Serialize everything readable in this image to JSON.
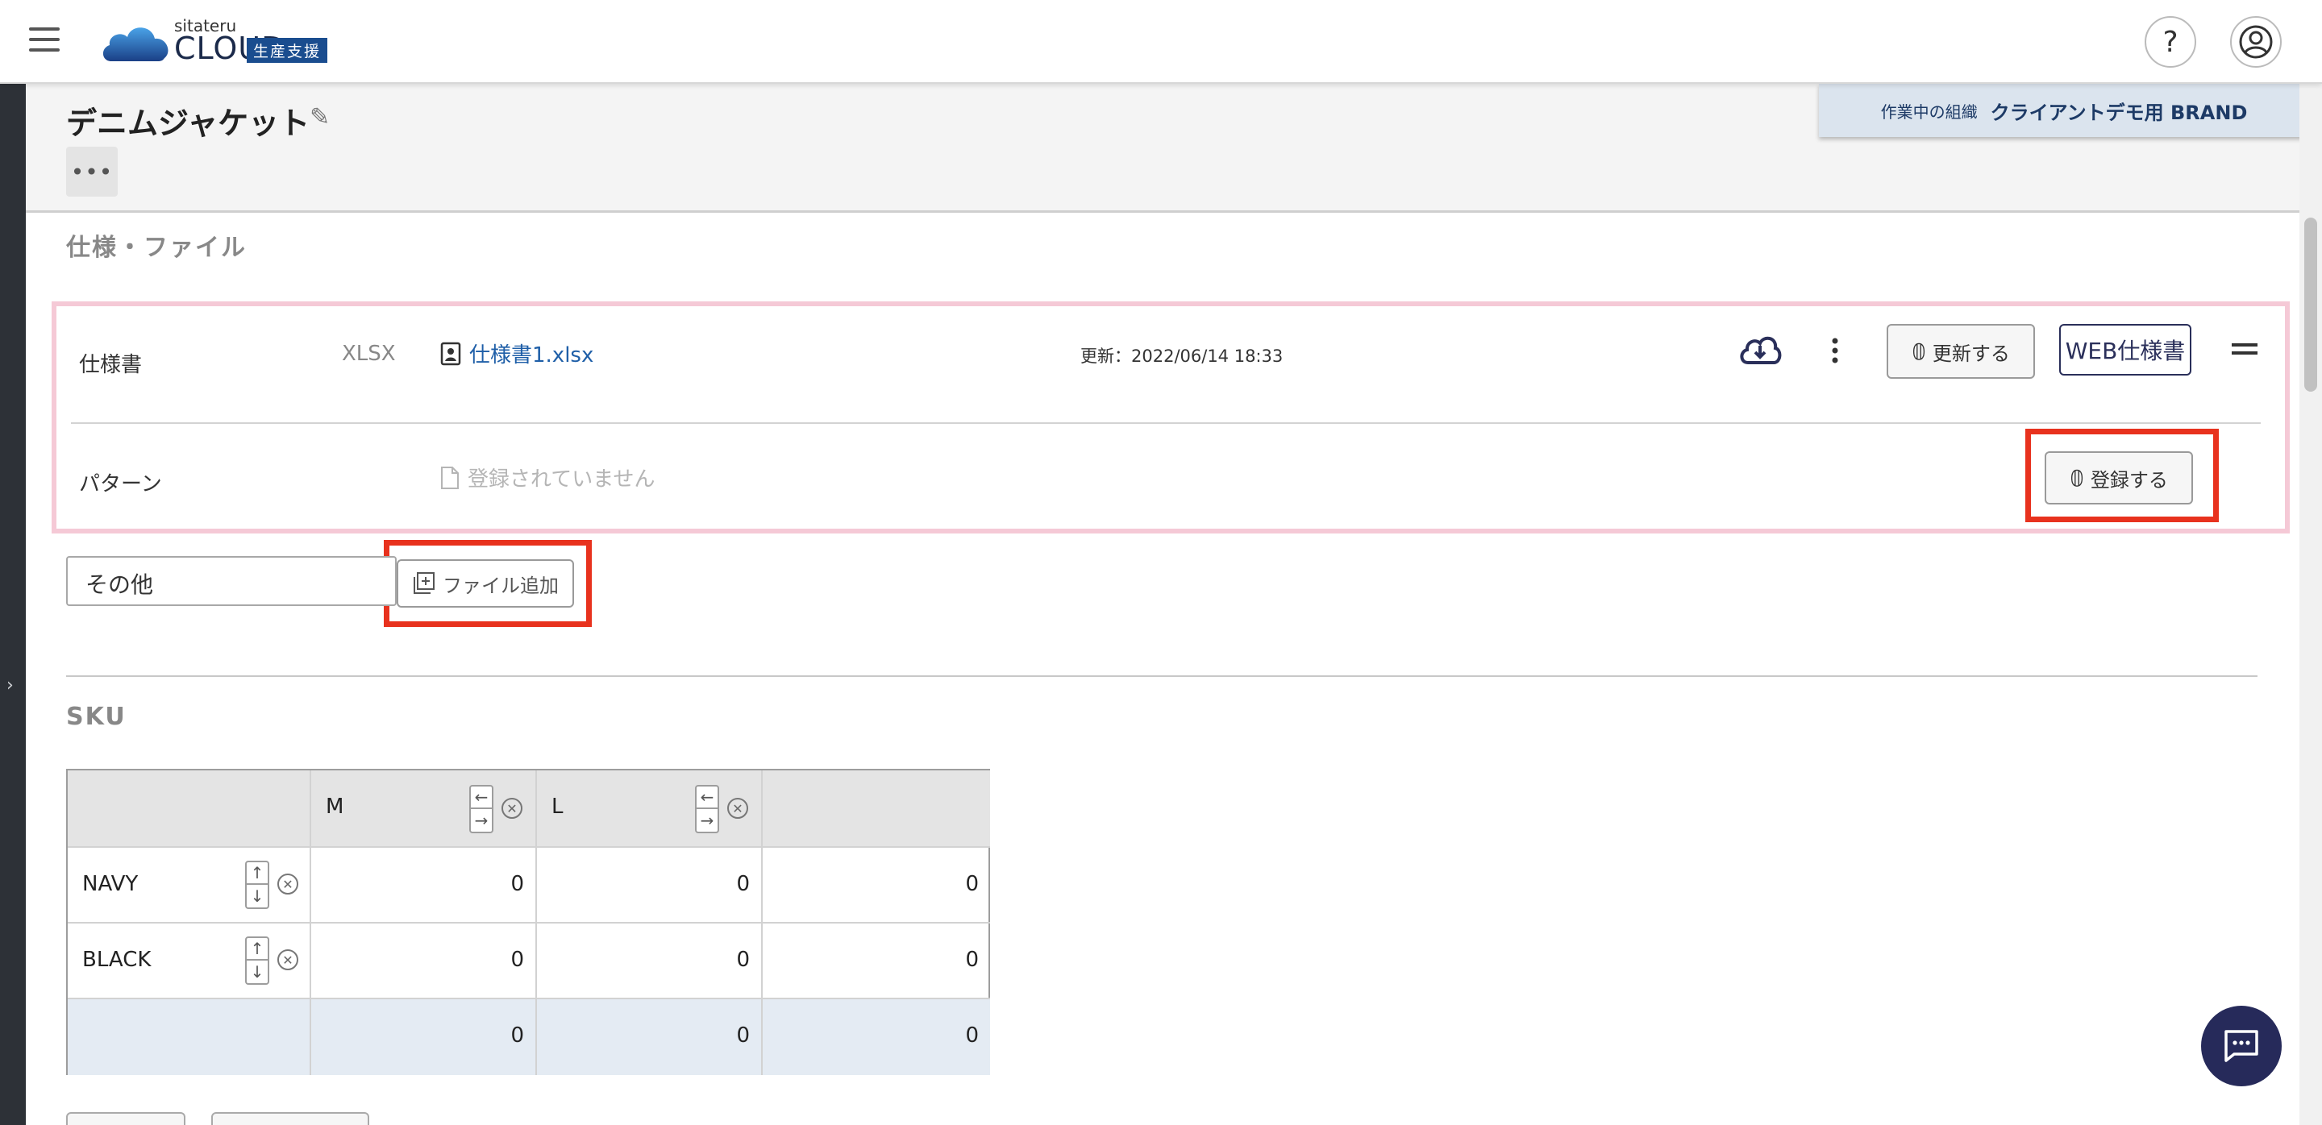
{
  "header": {
    "logo_small": "sitateru",
    "logo_big": "CLOUD",
    "logo_badge": "生産支援",
    "help_label": "?"
  },
  "page": {
    "title": "デニムジャケット",
    "more_label": "•••",
    "org_label": "作業中の組織",
    "org_name": "クライアントデモ用 BRAND"
  },
  "spec_section": {
    "title": "仕様・ファイル",
    "rows": [
      {
        "label": "仕様書",
        "filetype": "XLSX",
        "filename": "仕様書1.xlsx",
        "updated": "更新：2022/06/14 18:33",
        "update_button": "更新する",
        "web_button": "WEB仕様書"
      },
      {
        "label": "パターン",
        "empty_text": "登録されていません",
        "register_button": "登録する"
      }
    ],
    "other_input_value": "その他",
    "add_file_button": "ファイル追加"
  },
  "sku_section": {
    "title": "SKU",
    "columns": [
      "M",
      "L"
    ],
    "rows": [
      {
        "label": "NAVY",
        "values": [
          "0",
          "0",
          "0"
        ]
      },
      {
        "label": "BLACK",
        "values": [
          "0",
          "0",
          "0"
        ]
      }
    ],
    "totals": [
      "0",
      "0",
      "0"
    ]
  },
  "colors": {
    "accent": "#262a5a",
    "highlight_red": "#e8321e",
    "pink_border": "#f5c9d6",
    "link_blue": "#1f5fa8"
  },
  "icons": [
    "menu-icon",
    "cloud-logo-icon",
    "help-icon",
    "account-icon",
    "edit-icon",
    "file-person-icon",
    "file-empty-icon",
    "cloud-download-icon",
    "kebab-icon",
    "paperclip-icon",
    "drag-handle-icon",
    "add-file-icon",
    "arrow-left-icon",
    "arrow-right-icon",
    "arrow-up-icon",
    "arrow-down-icon",
    "remove-icon",
    "chat-icon"
  ]
}
